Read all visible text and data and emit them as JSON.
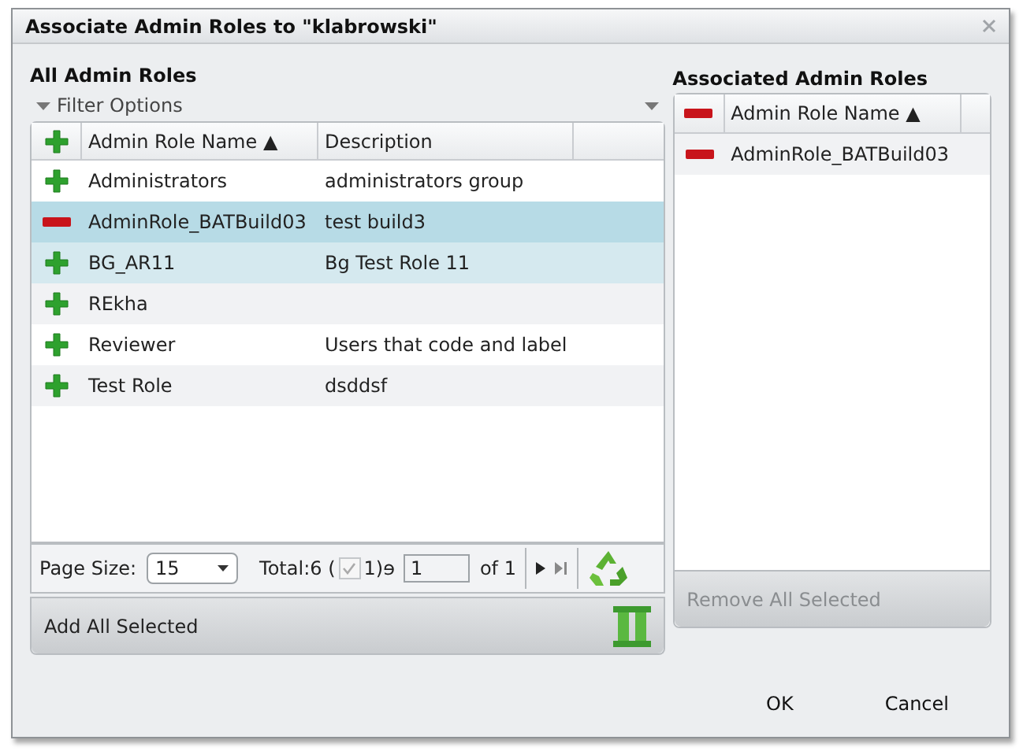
{
  "window": {
    "title": "Associate Admin Roles to \"klabrowski\""
  },
  "all_roles": {
    "title": "All Admin Roles",
    "filter": {
      "label": "Filter Options",
      "expanded": false
    },
    "columns": [
      "Admin Role Name ▲",
      "Description"
    ],
    "rows": [
      {
        "kind": "add",
        "name": "Administrators",
        "description": "administrators group",
        "selected": false,
        "hovered": false
      },
      {
        "kind": "remove",
        "name": "AdminRole_BATBuild03",
        "description": "test build3",
        "selected": true,
        "hovered": false
      },
      {
        "kind": "add",
        "name": "BG_AR11",
        "description": "Bg Test Role 11",
        "selected": false,
        "hovered": true
      },
      {
        "kind": "add",
        "name": "REkha",
        "description": "",
        "selected": false,
        "hovered": false
      },
      {
        "kind": "add",
        "name": "Reviewer",
        "description": "Users that code and label",
        "selected": false,
        "hovered": false
      },
      {
        "kind": "add",
        "name": "Test Role",
        "description": "dsddsf",
        "selected": false,
        "hovered": false
      }
    ],
    "pager": {
      "page_size_label": "Page Size:",
      "page_size": "15",
      "total_label": "Total:6 (",
      "selected_checked": true,
      "selected_count": "1)ɘ",
      "page": "1",
      "of_label": "of 1"
    },
    "action": {
      "label": "Add All Selected",
      "disabled": false
    }
  },
  "associated_roles": {
    "title": "Associated Admin Roles",
    "columns": [
      "Admin Role Name ▲"
    ],
    "rows": [
      {
        "kind": "remove",
        "name": "AdminRole_BATBuild03"
      }
    ],
    "action": {
      "label": "Remove All Selected",
      "disabled": true
    }
  },
  "buttons": [
    "OK",
    "Cancel"
  ]
}
